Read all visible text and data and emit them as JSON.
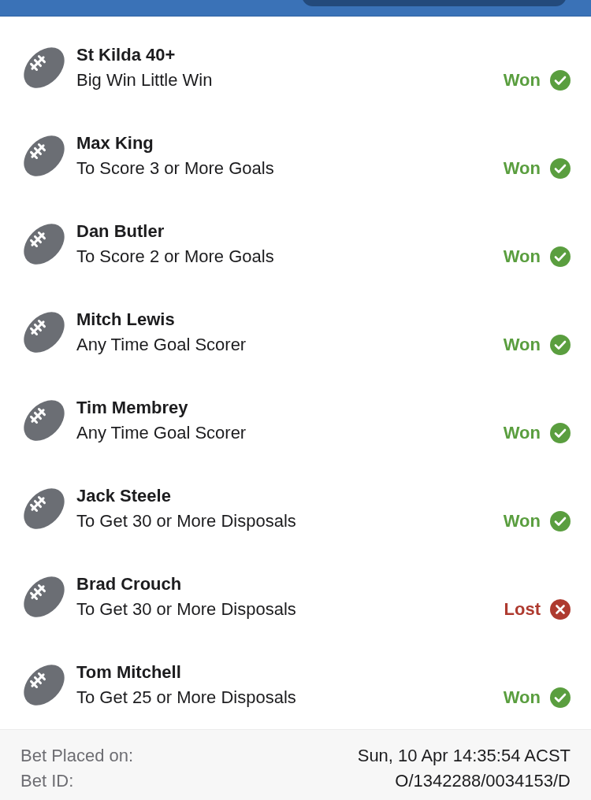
{
  "legs": [
    {
      "name": "St Kilda 40+",
      "market": "Big Win Little Win",
      "kind": "won",
      "result": "Won"
    },
    {
      "name": "Max King",
      "market": "To Score 3 or More Goals",
      "kind": "won",
      "result": "Won"
    },
    {
      "name": "Dan Butler",
      "market": "To Score 2 or More Goals",
      "kind": "won",
      "result": "Won"
    },
    {
      "name": "Mitch Lewis",
      "market": "Any Time Goal Scorer",
      "kind": "won",
      "result": "Won"
    },
    {
      "name": "Tim Membrey",
      "market": "Any Time Goal Scorer",
      "kind": "won",
      "result": "Won"
    },
    {
      "name": "Jack Steele",
      "market": "To Get 30 or More Disposals",
      "kind": "won",
      "result": "Won"
    },
    {
      "name": "Brad Crouch",
      "market": "To Get 30 or More Disposals",
      "kind": "lost",
      "result": "Lost"
    },
    {
      "name": "Tom Mitchell",
      "market": "To Get 25 or More Disposals",
      "kind": "won",
      "result": "Won"
    }
  ],
  "footer": {
    "rows": [
      {
        "label": "Bet Placed on:",
        "value": "Sun, 10 Apr 14:35:54 ACST"
      },
      {
        "label": "Bet ID:",
        "value": "O/1342288/0034153/D"
      }
    ]
  }
}
